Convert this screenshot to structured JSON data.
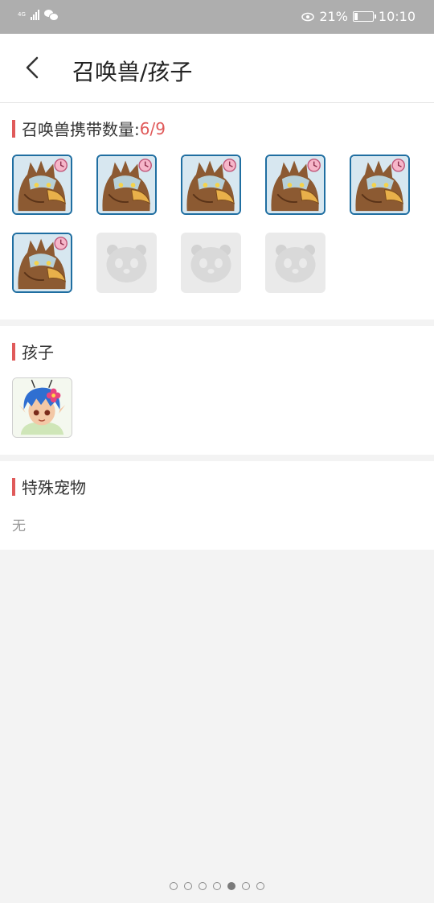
{
  "status_bar": {
    "network": "4G",
    "battery_percent_text": "21%",
    "battery_level": 0.21,
    "time": "10:10"
  },
  "header": {
    "title": "召唤兽/孩子"
  },
  "summons": {
    "label": "召唤兽携带数量:",
    "count": "6/9",
    "filled": 6,
    "capacity": 9
  },
  "children": {
    "label": "孩子"
  },
  "special_pets": {
    "label": "特殊宠物",
    "empty_text": "无"
  },
  "pager": {
    "pages": 7,
    "active_index": 4
  },
  "colors": {
    "accent": "#e05a5a",
    "pet_border": "#1f6ea1"
  }
}
